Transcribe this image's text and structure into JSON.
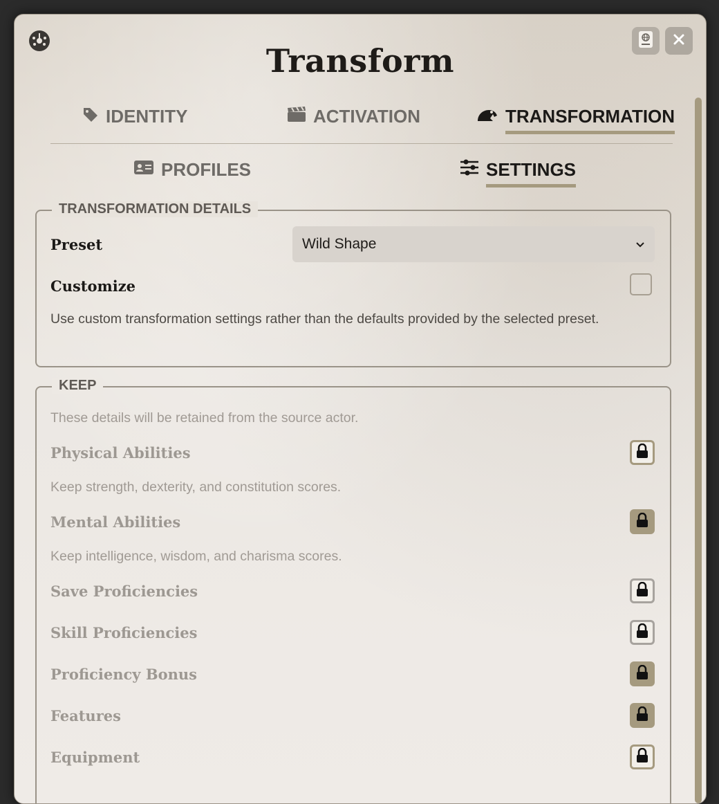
{
  "window": {
    "title": "Transform",
    "header_buttons": {
      "card_icon": "globe-card-icon",
      "close_icon": "close-icon"
    },
    "app_icon": "dial-icon"
  },
  "tabs": [
    {
      "label": "IDENTITY",
      "icon": "tag-icon",
      "active": false
    },
    {
      "label": "ACTIVATION",
      "icon": "clapperboard-icon",
      "active": false
    },
    {
      "label": "TRANSFORMATION",
      "icon": "frog-icon",
      "active": true
    }
  ],
  "subtabs": [
    {
      "label": "PROFILES",
      "icon": "id-card-icon",
      "active": false
    },
    {
      "label": "SETTINGS",
      "icon": "sliders-icon",
      "active": true
    }
  ],
  "details": {
    "legend": "TRANSFORMATION DETAILS",
    "preset_label": "Preset",
    "preset_value": "Wild Shape",
    "customize_label": "Customize",
    "customize_checked": false,
    "customize_hint": "Use custom transformation settings rather than the defaults provided by the selected preset."
  },
  "keep": {
    "legend": "KEEP",
    "intro": "These details will be retained from the source actor.",
    "items": [
      {
        "label": "Physical Abilities",
        "hint": "Keep strength, dexterity, and constitution scores.",
        "state": "off"
      },
      {
        "label": "Mental Abilities",
        "hint": "Keep intelligence, wisdom, and charisma scores.",
        "state": "on"
      },
      {
        "label": "Save Proficiencies",
        "state": "grey"
      },
      {
        "label": "Skill Proficiencies",
        "state": "grey"
      },
      {
        "label": "Proficiency Bonus",
        "state": "on"
      },
      {
        "label": "Features",
        "state": "on"
      },
      {
        "label": "Equipment",
        "state": "off"
      }
    ]
  },
  "colors": {
    "accent": "#a59a7f",
    "background": "#ece8e3"
  }
}
